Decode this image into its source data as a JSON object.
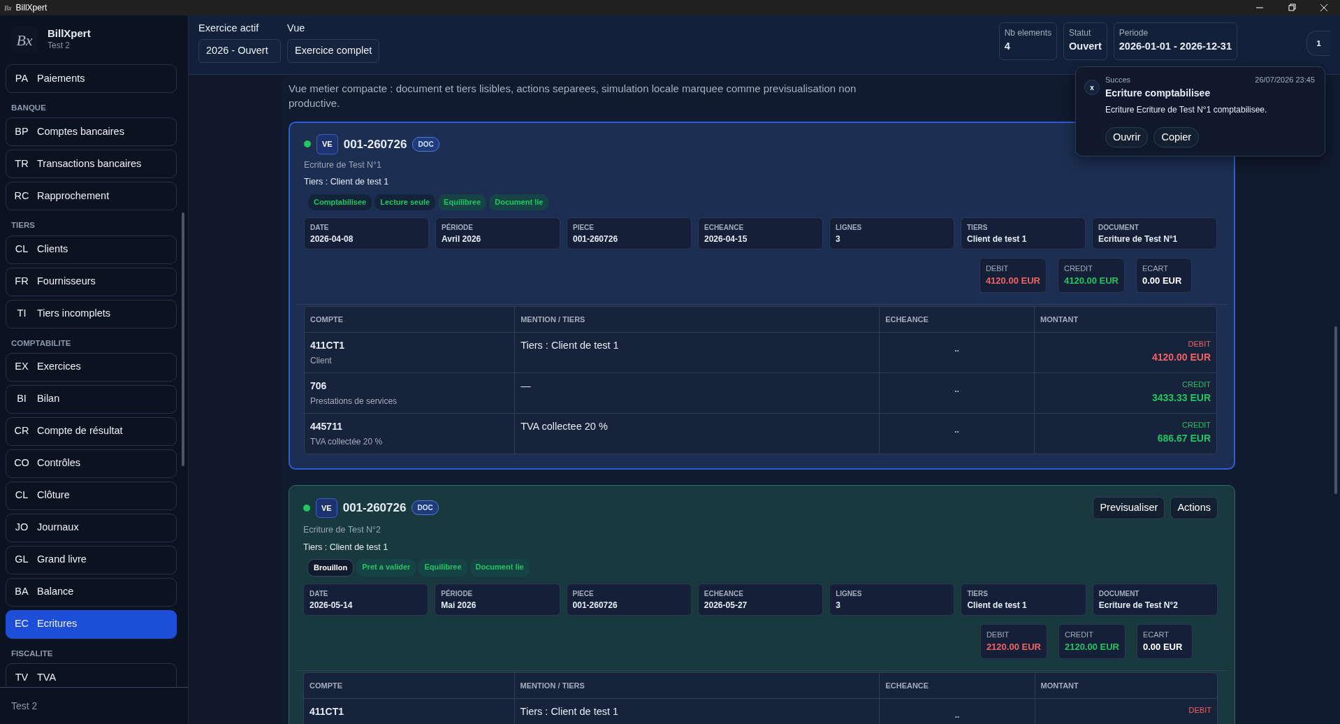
{
  "window": {
    "title": "BillXpert",
    "logo": "Bx"
  },
  "sidebar": {
    "app_name": "BillXpert",
    "logo": "Bx",
    "company": "Test 2",
    "footer": "Test 2",
    "sections": [
      {
        "items": [
          {
            "code": "PA",
            "label": "Paiements",
            "selected": false
          }
        ]
      },
      {
        "heading": "BANQUE",
        "items": [
          {
            "code": "BP",
            "label": "Comptes bancaires",
            "selected": false
          },
          {
            "code": "TR",
            "label": "Transactions bancaires",
            "selected": false
          },
          {
            "code": "RC",
            "label": "Rapprochement",
            "selected": false
          }
        ]
      },
      {
        "heading": "TIERS",
        "items": [
          {
            "code": "CL",
            "label": "Clients",
            "selected": false
          },
          {
            "code": "FR",
            "label": "Fournisseurs",
            "selected": false
          },
          {
            "code": "TI",
            "label": "Tiers incomplets",
            "selected": false
          }
        ]
      },
      {
        "heading": "COMPTABILITE",
        "items": [
          {
            "code": "EX",
            "label": "Exercices",
            "selected": false
          },
          {
            "code": "BI",
            "label": "Bilan",
            "selected": false
          },
          {
            "code": "CR",
            "label": "Compte de résultat",
            "selected": false
          },
          {
            "code": "CO",
            "label": "Contrôles",
            "selected": false
          },
          {
            "code": "CL",
            "label": "Clôture",
            "selected": false
          },
          {
            "code": "JO",
            "label": "Journaux",
            "selected": false
          },
          {
            "code": "GL",
            "label": "Grand livre",
            "selected": false
          },
          {
            "code": "BA",
            "label": "Balance",
            "selected": false
          },
          {
            "code": "EC",
            "label": "Ecritures",
            "selected": true
          }
        ]
      },
      {
        "heading": "FISCALITE",
        "items": [
          {
            "code": "TV",
            "label": "TVA",
            "selected": false
          }
        ]
      }
    ]
  },
  "header": {
    "selectors": [
      {
        "label": "Exercice actif",
        "value": "2026 - Ouvert"
      },
      {
        "label": "Vue",
        "value": "Exercice complet"
      }
    ],
    "stats": [
      {
        "label": "Nb elements",
        "value": "4"
      },
      {
        "label": "Statut",
        "value": "Ouvert"
      },
      {
        "label": "Periode",
        "value": "2026-01-01 - 2026-12-31"
      }
    ],
    "notification_count": "1"
  },
  "intro": "Vue metier compacte : document et tiers lisibles, actions separees, simulation locale marquee comme previsualisation non productive.",
  "entries": [
    {
      "kind": "selected",
      "color": "#22c55e",
      "journal": "VE",
      "number": "001-260726",
      "doc_badge": "DOC",
      "title": "Ecriture de Test N°1",
      "tiers": "Tiers : Client de test 1",
      "tags": [
        {
          "label": "Comptabilisee",
          "kind": "dark"
        },
        {
          "label": "Lecture seule",
          "kind": "dark"
        },
        {
          "label": "Equilibree",
          "kind": "soft"
        },
        {
          "label": "Document lie",
          "kind": "soft"
        }
      ],
      "fields": [
        {
          "label": "DATE",
          "value": "2026-04-08"
        },
        {
          "label": "PÉRIODE",
          "value": "Avril 2026"
        },
        {
          "label": "PIECE",
          "value": "001-260726"
        },
        {
          "label": "ECHEANCE",
          "value": "2026-04-15"
        },
        {
          "label": "LIGNES",
          "value": "3"
        },
        {
          "label": "TIERS",
          "value": "Client de test 1"
        },
        {
          "label": "DOCUMENT",
          "value": "Ecriture de Test N°1"
        }
      ],
      "totals": [
        {
          "label": "DEBIT",
          "value": "4120.00 EUR",
          "kind": "debit"
        },
        {
          "label": "CREDIT",
          "value": "4120.00 EUR",
          "kind": "credit"
        },
        {
          "label": "ECART",
          "value": "0.00 EUR",
          "kind": "neutral"
        }
      ],
      "columns": [
        "COMPTE",
        "MENTION / TIERS",
        "ECHEANCE",
        "MONTANT"
      ],
      "lines": [
        {
          "account": "411CT1",
          "account_name": "Client",
          "mention": "Tiers : Client de test 1",
          "due": "..",
          "side": "DEBIT",
          "kind": "debit",
          "amount": "4120.00 EUR"
        },
        {
          "account": "706",
          "account_name": "Prestations de services",
          "mention": "—",
          "due": "..",
          "side": "CREDIT",
          "kind": "credit",
          "amount": "3433.33 EUR"
        },
        {
          "account": "445711",
          "account_name": "TVA collectée 20 %",
          "mention": "TVA collectee 20 %",
          "due": "..",
          "side": "CREDIT",
          "kind": "credit",
          "amount": "686.67 EUR"
        }
      ]
    },
    {
      "kind": "draft",
      "color": "#22c55e",
      "journal": "VE",
      "number": "001-260726",
      "doc_badge": "DOC",
      "title": "Ecriture de Test N°2",
      "tiers": "Tiers : Client de test 1",
      "actions": [
        "Previsualiser",
        "Actions"
      ],
      "tags": [
        {
          "label": "Brouillon",
          "kind": "neutral"
        },
        {
          "label": "Pret a valider",
          "kind": "soft"
        },
        {
          "label": "Equilibree",
          "kind": "soft"
        },
        {
          "label": "Document lie",
          "kind": "soft"
        }
      ],
      "fields": [
        {
          "label": "DATE",
          "value": "2026-05-14"
        },
        {
          "label": "PÉRIODE",
          "value": "Mai 2026"
        },
        {
          "label": "PIECE",
          "value": "001-260726"
        },
        {
          "label": "ECHEANCE",
          "value": "2026-05-27"
        },
        {
          "label": "LIGNES",
          "value": "3"
        },
        {
          "label": "TIERS",
          "value": "Client de test 1"
        },
        {
          "label": "DOCUMENT",
          "value": "Ecriture de Test N°2"
        }
      ],
      "totals": [
        {
          "label": "DEBIT",
          "value": "2120.00 EUR",
          "kind": "debit"
        },
        {
          "label": "CREDIT",
          "value": "2120.00 EUR",
          "kind": "credit"
        },
        {
          "label": "ECART",
          "value": "0.00 EUR",
          "kind": "neutral"
        }
      ],
      "columns": [
        "COMPTE",
        "MENTION / TIERS",
        "ECHEANCE",
        "MONTANT"
      ],
      "lines": [
        {
          "account": "411CT1",
          "mention": "Tiers : Client de test 1",
          "due": "..",
          "side": "DEBIT",
          "kind": "debit"
        }
      ]
    }
  ],
  "toast": {
    "close": "x",
    "category": "Succes",
    "time": "26/07/2026 23:45",
    "title": "Ecriture comptabilisee",
    "message": "Ecriture Ecriture de Test N°1 comptabilisee.",
    "buttons": [
      "Ouvrir",
      "Copier"
    ]
  }
}
